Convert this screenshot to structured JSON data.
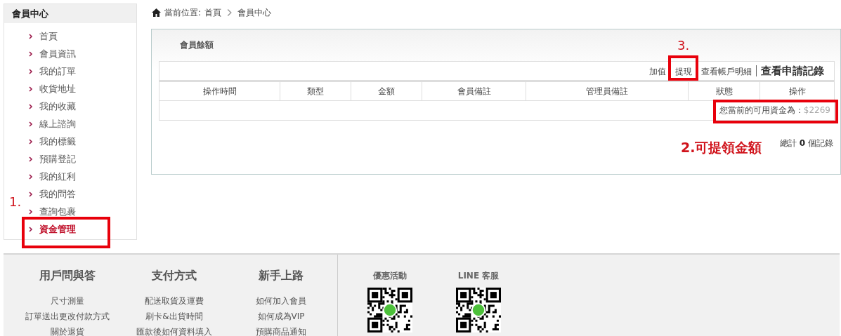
{
  "sidebar": {
    "title": "會員中心",
    "items": [
      {
        "label": "首頁",
        "selected": false
      },
      {
        "label": "會員資訊",
        "selected": false
      },
      {
        "label": "我的訂單",
        "selected": false
      },
      {
        "label": "收貨地址",
        "selected": false
      },
      {
        "label": "我的收藏",
        "selected": false
      },
      {
        "label": "線上諮詢",
        "selected": false
      },
      {
        "label": "我的標籤",
        "selected": false
      },
      {
        "label": "預購登記",
        "selected": false
      },
      {
        "label": "我的紅利",
        "selected": false
      },
      {
        "label": "我的問答",
        "selected": false
      },
      {
        "label": "查詢包裹",
        "selected": false
      },
      {
        "label": "資金管理",
        "selected": true
      }
    ]
  },
  "breadcrumb": {
    "prefix": "當前位置:",
    "items": [
      "首頁",
      "會員中心"
    ]
  },
  "panel": {
    "title": "會員餘額",
    "actions": [
      {
        "label": "加值",
        "emphasis": false
      },
      {
        "label": "提現",
        "emphasis": false
      },
      {
        "label": "查看帳戶明細",
        "emphasis": false
      },
      {
        "label": "查看申請記錄",
        "emphasis": true
      }
    ],
    "table": {
      "columns": [
        "操作時間",
        "類型",
        "金額",
        "會員備註",
        "管理員備註",
        "狀態",
        "操作"
      ],
      "balance_row": {
        "label": "您當前的可用資金為：",
        "amount": "$2269"
      }
    },
    "total": "總計 **0** 個記錄"
  },
  "annotations": [
    {
      "label": "1."
    },
    {
      "label": "3."
    },
    {
      "label": "2.可提領金額"
    }
  ],
  "footer": {
    "columns": [
      {
        "title": "用戶問與答",
        "links": [
          "尺寸測量",
          "訂單送出更改付款方式",
          "關於退貨"
        ]
      },
      {
        "title": "支付方式",
        "links": [
          "配送取貨及運費",
          "刷卡&出貨時間",
          "匯款後如何資料填入"
        ]
      },
      {
        "title": "新手上路",
        "links": [
          "如何加入會員",
          "如何成為VIP",
          "預購商品通知"
        ]
      }
    ],
    "qr_codes": [
      {
        "title": "優惠活動"
      },
      {
        "title": "LINE 客服"
      }
    ]
  }
}
